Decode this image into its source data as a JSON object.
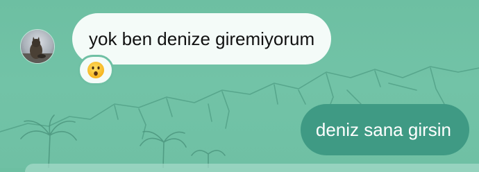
{
  "conversation": {
    "messages": [
      {
        "direction": "incoming",
        "text": "yok ben denize giremiyorum",
        "reaction": "surprised-face-emoji"
      },
      {
        "direction": "outgoing",
        "text": "deniz sana girsin"
      }
    ]
  },
  "icons": {
    "avatar": "cat-photo-avatar",
    "reaction": "surprised-face-emoji"
  },
  "colors": {
    "background": "#6fc0a4",
    "incoming_bubble": "#f4fbf8",
    "outgoing_bubble": "#3f9a84",
    "outgoing_text": "#ffffff",
    "incoming_text": "#111111"
  }
}
